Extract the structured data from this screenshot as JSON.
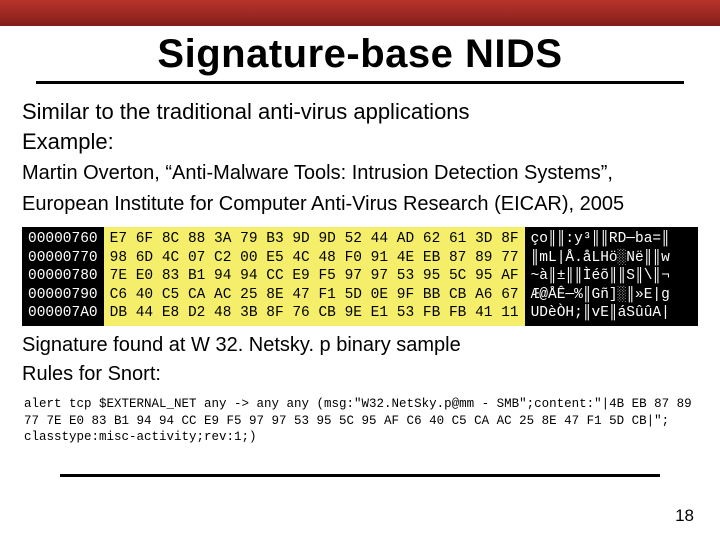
{
  "title": "Signature-base NIDS",
  "para1": "Similar to the traditional anti-virus applications",
  "para2": "Example:",
  "cite1": "Martin Overton, “Anti-Malware Tools: Intrusion Detection Systems”,",
  "cite2": "European Institute for Computer Anti-Virus Research (EICAR), 2005",
  "hex": {
    "addr": "00000760\n00000770\n00000780\n00000790\n000007A0",
    "bytes": "E7 6F 8C 88 3A 79 B3 9D 9D 52 44 AD 62 61 3D 8F\n98 6D 4C 07 C2 00 E5 4C 48 F0 91 4E EB 87 89 77\n7E E0 83 B1 94 94 CC E9 F5 97 97 53 95 5C 95 AF\nC6 40 C5 CA AC 25 8E 47 F1 5D 0E 9F BB CB A6 67\nDB 44 E8 D2 48 3B 8F 76 CB 9E E1 53 FB FB 41 11"
  },
  "ascii_lines": [
    "ço║║:y³║║RD─ba=║",
    "║mL|Å.åLHö░Në║║w",
    "~à║±║║Ìéõ║║S║\\║¬",
    "Æ@ÅÊ─%║Gñ]░║»E|g",
    "UDèÒH;║vE║áSûûA|"
  ],
  "sig": "Signature found at W 32. Netsky. p binary sample",
  "rules": "Rules for Snort:",
  "snort": "alert tcp $EXTERNAL_NET any -> any any (msg:\"W32.NetSky.p@mm - SMB\";content:\"|4B EB 87 89 77 7E E0 83 B1 94 94 CC E9 F5 97 97 53 95 5C 95 AF C6 40 C5 CA AC 25 8E 47 F1 5D CB|\"; classtype:misc-activity;rev:1;)",
  "page": "18"
}
